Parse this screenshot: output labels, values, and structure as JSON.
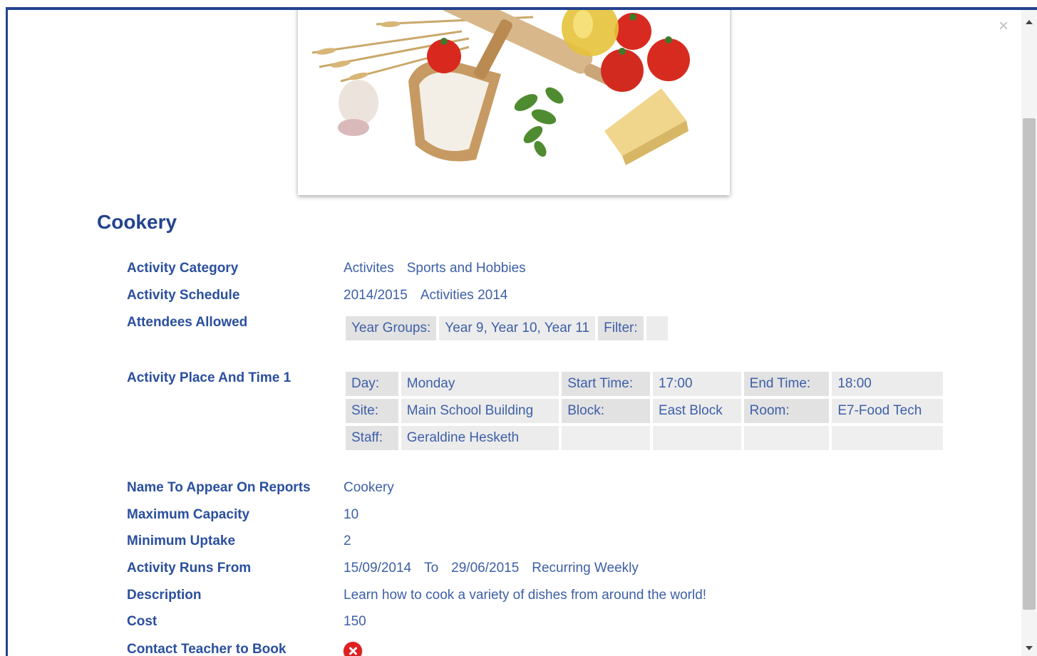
{
  "activity": {
    "title": "Cookery",
    "close_symbol": "×",
    "fields": {
      "category_label": "Activity Category",
      "category_values": [
        "Activites",
        "Sports and Hobbies"
      ],
      "schedule_label": "Activity Schedule",
      "schedule_values": [
        "2014/2015",
        "Activities 2014"
      ],
      "attendees_label": "Attendees Allowed",
      "attendees": {
        "year_groups_key": "Year Groups:",
        "year_groups_value": "Year 9, Year 10, Year 11",
        "filter_key": "Filter:",
        "filter_value": ""
      },
      "place_time_label": "Activity Place And Time 1",
      "place_time": {
        "day_key": "Day:",
        "day_value": "Monday",
        "start_key": "Start Time:",
        "start_value": "17:00",
        "end_key": "End Time:",
        "end_value": "18:00",
        "site_key": "Site:",
        "site_value": "Main School Building",
        "block_key": "Block:",
        "block_value": "East Block",
        "room_key": "Room:",
        "room_value": "E7-Food Tech",
        "staff_key": "Staff:",
        "staff_value": "Geraldine Hesketh"
      },
      "report_name_label": "Name To Appear On Reports",
      "report_name_value": "Cookery",
      "max_capacity_label": "Maximum Capacity",
      "max_capacity_value": "10",
      "min_uptake_label": "Minimum Uptake",
      "min_uptake_value": "2",
      "runs_from_label": "Activity Runs From",
      "runs_from": {
        "start": "15/09/2014",
        "to_word": "To",
        "end": "29/06/2015",
        "recurrence": "Recurring Weekly"
      },
      "description_label": "Description",
      "description_value": "Learn how to cook a variety of dishes from around the world!",
      "cost_label": "Cost",
      "cost_value": "150",
      "contact_label": "Contact Teacher to Book",
      "contact_icon": "cross-icon"
    }
  },
  "colors": {
    "heading": "#23438e",
    "label": "#2a4f9e",
    "value": "#3d5fa7",
    "cell_bg": "#ececec",
    "no_icon": "#e02020"
  }
}
